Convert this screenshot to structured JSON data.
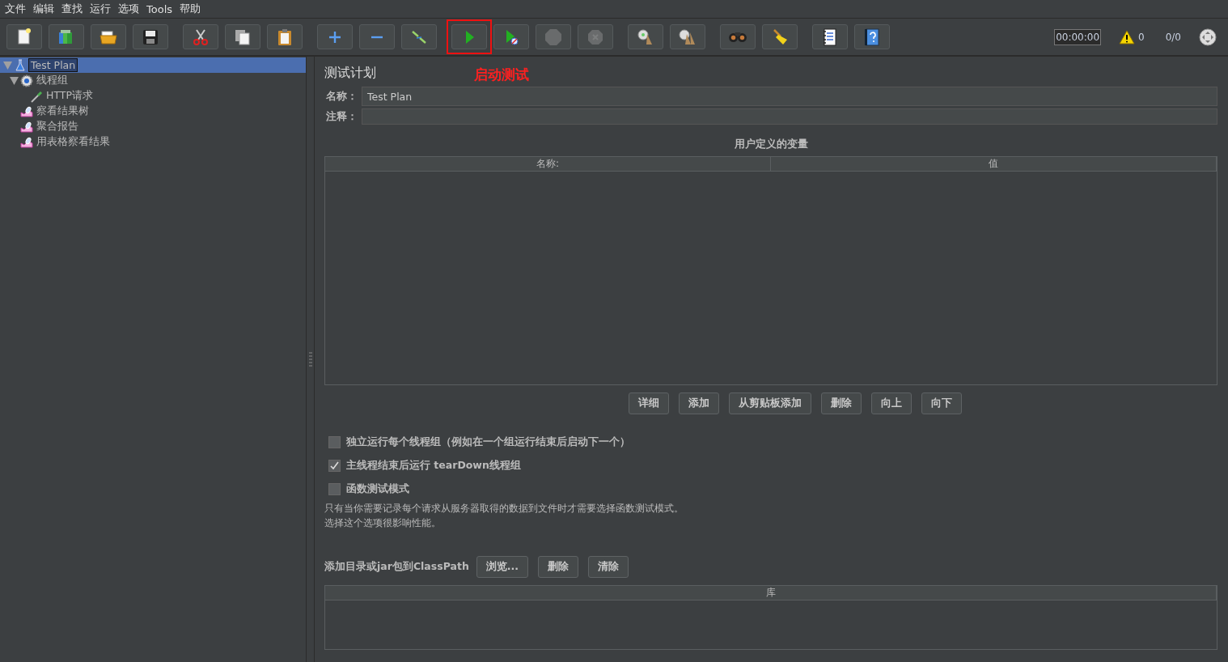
{
  "menu": [
    {
      "label": "文件"
    },
    {
      "label": "编辑"
    },
    {
      "label": "查找"
    },
    {
      "label": "运行"
    },
    {
      "label": "选项"
    },
    {
      "label": "Tools"
    },
    {
      "label": "帮助"
    }
  ],
  "toolbar": {
    "groups": [
      [
        {
          "kind": "new",
          "highlighted": false,
          "disabled": false
        },
        {
          "kind": "templates",
          "highlighted": false,
          "disabled": false
        },
        {
          "kind": "open",
          "highlighted": false,
          "disabled": false
        },
        {
          "kind": "save",
          "highlighted": false,
          "disabled": false
        }
      ],
      [
        {
          "kind": "cut",
          "highlighted": false,
          "disabled": false
        },
        {
          "kind": "copy",
          "highlighted": false,
          "disabled": false
        },
        {
          "kind": "paste",
          "highlighted": false,
          "disabled": false
        }
      ],
      [
        {
          "kind": "expand",
          "highlighted": false,
          "disabled": false
        },
        {
          "kind": "collapse",
          "highlighted": false,
          "disabled": false
        },
        {
          "kind": "toggle",
          "highlighted": false,
          "disabled": false
        }
      ],
      [
        {
          "kind": "start",
          "highlighted": true,
          "disabled": false
        },
        {
          "kind": "start_no_pause",
          "highlighted": false,
          "disabled": false
        },
        {
          "kind": "stop",
          "highlighted": false,
          "disabled": true
        },
        {
          "kind": "shutdown",
          "highlighted": false,
          "disabled": true
        }
      ],
      [
        {
          "kind": "clear",
          "highlighted": false,
          "disabled": false
        },
        {
          "kind": "clear_all",
          "highlighted": false,
          "disabled": false
        }
      ],
      [
        {
          "kind": "search",
          "highlighted": false,
          "disabled": false
        },
        {
          "kind": "reset_search",
          "highlighted": false,
          "disabled": false
        }
      ],
      [
        {
          "kind": "functions",
          "highlighted": false,
          "disabled": false
        },
        {
          "kind": "help",
          "highlighted": false,
          "disabled": false
        }
      ]
    ]
  },
  "annotation": {
    "text": "启动测试"
  },
  "status": {
    "timer": "00:00:00",
    "warnings": "0",
    "threads": "0/0"
  },
  "tree": [
    {
      "label": "Test Plan",
      "kind": "plan",
      "selected": true,
      "expanded": true,
      "children": [
        {
          "label": "线程组",
          "kind": "thread_group",
          "selected": false,
          "expanded": true,
          "children": [
            {
              "label": "HTTP请求",
              "kind": "sampler",
              "selected": false
            }
          ]
        },
        {
          "label": "察看结果树",
          "kind": "listener",
          "selected": false
        },
        {
          "label": "聚合报告",
          "kind": "listener",
          "selected": false
        },
        {
          "label": "用表格察看结果",
          "kind": "listener",
          "selected": false
        }
      ]
    }
  ],
  "plan": {
    "title": "测试计划",
    "name_label": "名称：",
    "name_value": "Test Plan",
    "comment_label": "注释：",
    "variables": {
      "title": "用户定义的变量",
      "columns": [
        "名称:",
        "值"
      ]
    },
    "buttons": [
      "详细",
      "添加",
      "从剪贴板添加",
      "删除",
      "向上",
      "向下"
    ],
    "options": [
      {
        "label": "独立运行每个线程组（例如在一个组运行结束后启动下一个）",
        "checked": false
      },
      {
        "label": "主线程结束后运行 tearDown线程组",
        "checked": true
      },
      {
        "label": "函数测试模式",
        "checked": false
      }
    ],
    "note": [
      "只有当你需要记录每个请求从服务器取得的数据到文件时才需要选择函数测试模式。",
      "选择这个选项很影响性能。"
    ],
    "classpath": {
      "label": "添加目录或jar包到ClassPath",
      "buttons": [
        "浏览...",
        "删除",
        "清除"
      ],
      "columns": [
        "库"
      ]
    }
  }
}
